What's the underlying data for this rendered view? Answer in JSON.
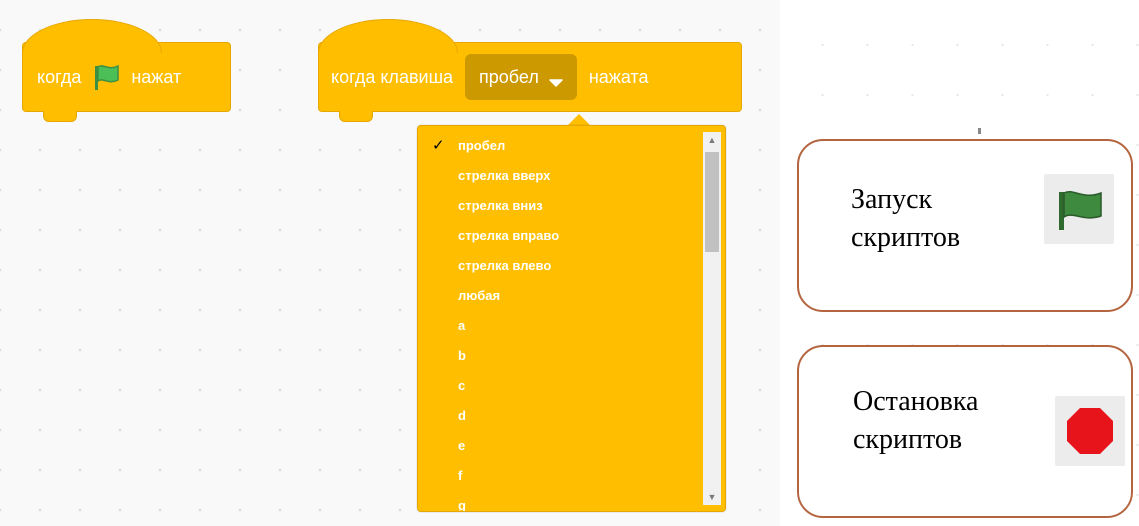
{
  "workspace": {
    "hat_flag": {
      "text_before": "когда",
      "text_after": "нажат",
      "icon": "green-flag-icon"
    },
    "hat_key": {
      "text_before": "когда клавиша",
      "selected_key": "пробел",
      "text_after": "нажата",
      "icon": "chevron-down-icon"
    },
    "dropdown": {
      "check_mark": "✓",
      "items": [
        "пробел",
        "стрелка вверх",
        "стрелка вниз",
        "стрелка вправо",
        "стрелка влево",
        "любая",
        "a",
        "b",
        "c",
        "d",
        "e",
        "f",
        "g"
      ],
      "selected_index": 0
    }
  },
  "legend": {
    "start": {
      "line1": "Запуск",
      "line2": "скриптов",
      "icon": "green-flag-icon"
    },
    "stop": {
      "line1": "Остановка",
      "line2": "скриптов",
      "icon": "red-stop-icon"
    }
  },
  "colors": {
    "block_yellow": "#ffbf00",
    "block_dark_yellow": "#cc9900",
    "flag_green": "#4cbf56",
    "card_border": "#b4653f",
    "stop_red": "#e8141b"
  }
}
